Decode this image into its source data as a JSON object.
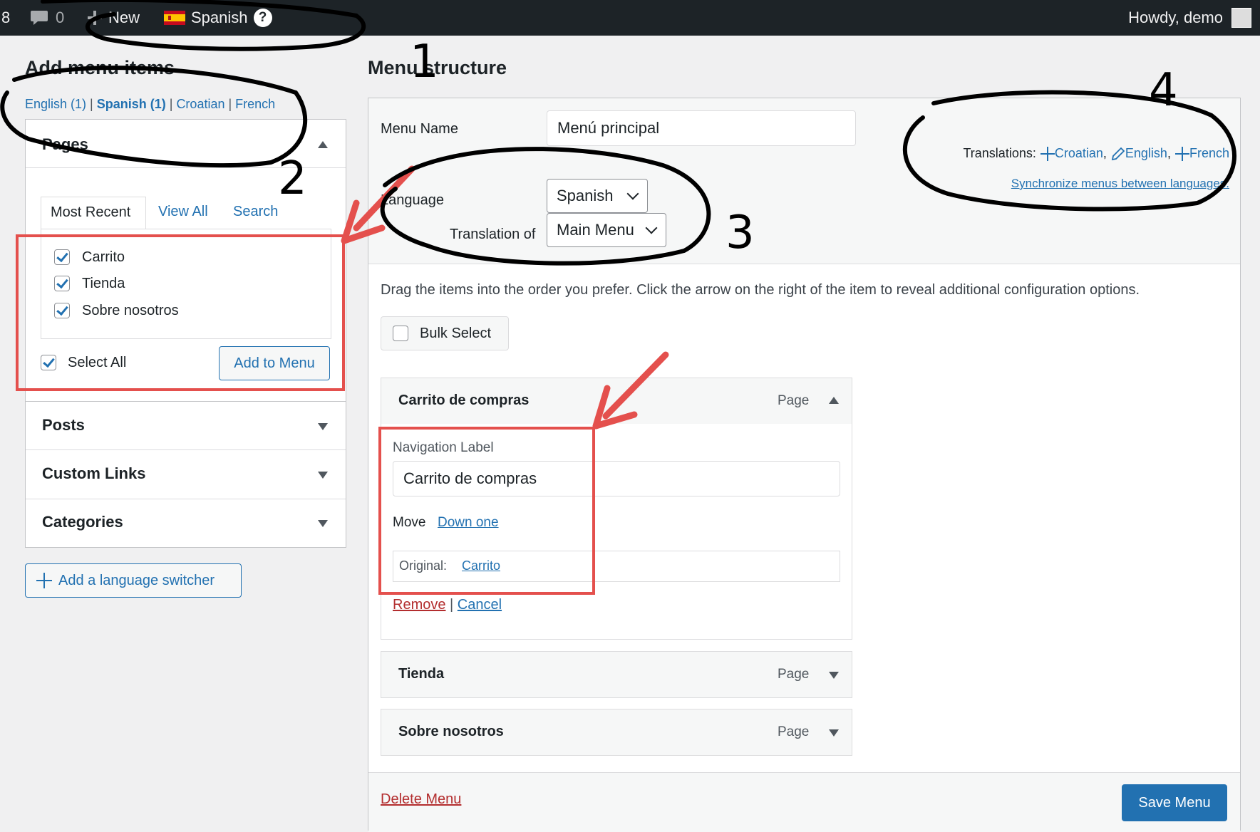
{
  "adminbar": {
    "updates_count": "8",
    "comments_count": "0",
    "new_label": "New",
    "language_label": "Spanish",
    "help_label": "?",
    "greeting": "Howdy, demo"
  },
  "left": {
    "title": "Add menu items",
    "lang_tabs": [
      {
        "label": "English (1)"
      },
      {
        "label": "Spanish (1)"
      },
      {
        "label": "Croatian"
      },
      {
        "label": "French"
      }
    ],
    "lang_separator": " | ",
    "pages": {
      "title": "Pages",
      "tabs": [
        "Most Recent",
        "View All",
        "Search"
      ],
      "items": [
        {
          "label": "Carrito",
          "checked": true
        },
        {
          "label": "Tienda",
          "checked": true
        },
        {
          "label": "Sobre nosotros",
          "checked": true
        }
      ],
      "select_all": "Select All",
      "add_button": "Add to Menu"
    },
    "sections": [
      "Posts",
      "Custom Links",
      "Categories"
    ],
    "switcher_button": "Add a language switcher"
  },
  "right": {
    "title": "Menu structure",
    "menu_name_label": "Menu Name",
    "menu_name_value": "Menú principal",
    "language_label": "Language",
    "language_value": "Spanish",
    "translation_of_label": "Translation of",
    "translation_of_value": "Main Menu",
    "translations_label": "Translations:",
    "translations": [
      {
        "label": "Croatian",
        "icon": "plus-icon"
      },
      {
        "label": "English",
        "icon": "pencil-icon"
      },
      {
        "label": "French",
        "icon": "plus-icon"
      }
    ],
    "sync_link": "Synchronize menus between languages.",
    "instructions": "Drag the items into the order you prefer. Click the arrow on the right of the item to reveal additional configuration options.",
    "bulk_select": "Bulk Select",
    "items": [
      {
        "title": "Carrito de compras",
        "type": "Page",
        "expanded": true,
        "nav_label_caption": "Navigation Label",
        "nav_label_value": "Carrito de compras",
        "move_label": "Move",
        "move_link": "Down one",
        "original_label": "Original:",
        "original_link": "Carrito",
        "remove": "Remove",
        "cancel": "Cancel",
        "separator": " | "
      },
      {
        "title": "Tienda",
        "type": "Page",
        "expanded": false
      },
      {
        "title": "Sobre nosotros",
        "type": "Page",
        "expanded": false
      }
    ],
    "delete_menu": "Delete Menu",
    "save_button": "Save Menu"
  },
  "annotations": {
    "numbers": [
      "1",
      "2",
      "3",
      "4"
    ],
    "highlight_color": "#e4504d",
    "ink_color": "#000000"
  },
  "colors": {
    "adminbar_bg": "#1d2327",
    "link": "#2271b1",
    "primary_button": "#2271b1",
    "danger_link": "#b32d2e"
  }
}
